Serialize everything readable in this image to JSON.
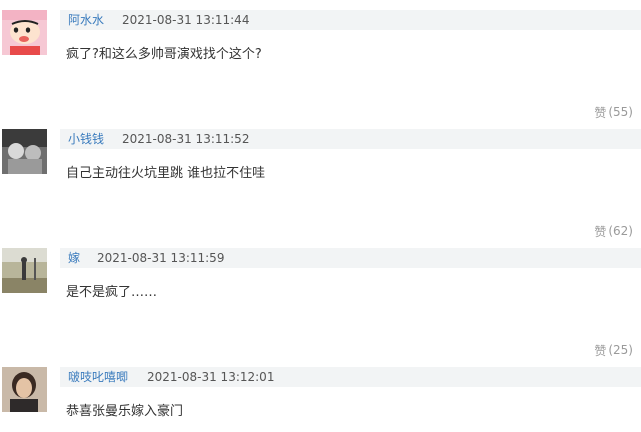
{
  "comments": [
    {
      "user": "阿水水",
      "time": "2021-08-31 13:11:44",
      "text": "疯了?和这么多帅哥演戏找个这个?",
      "like_word": "赞",
      "like_count": "(55)",
      "avatar_icon": "cartoon-avatar-icon"
    },
    {
      "user": "小钱钱",
      "time": "2021-08-31 13:11:52",
      "text": "自己主动往火坑里跳 谁也拉不住哇",
      "like_word": "赞",
      "like_count": "(62)",
      "avatar_icon": "photo-avatar-icon"
    },
    {
      "user": "嫁",
      "time": "2021-08-31 13:11:59",
      "text": "是不是疯了……",
      "like_word": "赞",
      "like_count": "(25)",
      "avatar_icon": "photo-avatar-icon"
    },
    {
      "user": "啵吱叱嘻唧",
      "time": "2021-08-31 13:12:01",
      "text": "恭喜张曼乐嫁入豪门",
      "like_word": "",
      "like_count": "",
      "avatar_icon": "photo-avatar-icon"
    }
  ],
  "colors": {
    "username": "#3a7bbd",
    "meta_bg": "#f2f4f5",
    "like": "#9a9a9a",
    "text": "#333333"
  }
}
